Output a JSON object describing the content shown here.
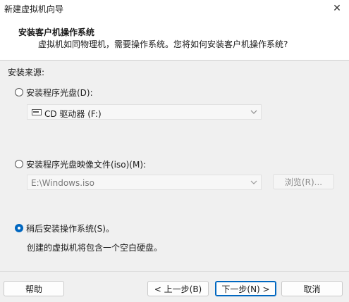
{
  "window": {
    "title": "新建虚拟机向导",
    "close_glyph": "✕"
  },
  "header": {
    "title": "安装客户机操作系统",
    "subtitle": "虚拟机如同物理机，需要操作系统。您将如何安装客户机操作系统?"
  },
  "install_source": {
    "label": "安装来源:",
    "options": [
      {
        "label": "安装程序光盘(D):",
        "selected": false
      },
      {
        "label": "安装程序光盘映像文件(iso)(M):",
        "selected": false
      },
      {
        "label": "稍后安装操作系统(S)。",
        "selected": true
      }
    ],
    "disc_select": {
      "value": "CD 驱动器 (F:)",
      "icon": "optical-drive-icon"
    },
    "iso_select": {
      "value": "E:\\Windows.iso",
      "enabled": false
    },
    "browse_label": "浏览(R)...",
    "later_description": "创建的虚拟机将包含一个空白硬盘。"
  },
  "footer": {
    "help": "帮助",
    "back": "< 上一步(B)",
    "next": "下一步(N) >",
    "cancel": "取消"
  },
  "colors": {
    "accent": "#0067c0",
    "background": "#f0f0f0",
    "header_background": "#ffffff"
  }
}
